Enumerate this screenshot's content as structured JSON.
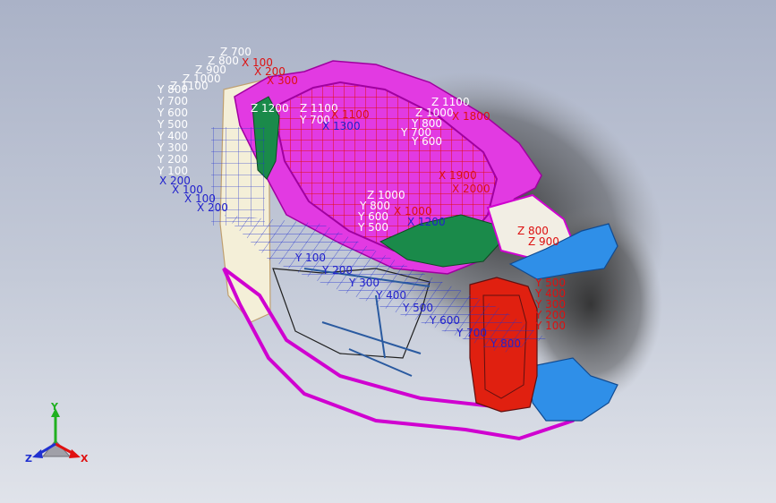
{
  "colors": {
    "background_top": "#aab2c7",
    "background_bottom": "#e0e3ea",
    "body_panel": "#d000d0",
    "mesh_red": "#e01010",
    "mesh_blue": "#2030d0",
    "green_panel": "#1a8a4a",
    "blue_part": "#2f8fe8",
    "red_part": "#e02010",
    "label_white": "#ffffff",
    "label_red": "#dd1111",
    "label_blue": "#2222cc",
    "triad_x": "#e01010",
    "triad_y": "#20b020",
    "triad_z": "#2030d0"
  },
  "left_grid_labels": {
    "y_ticks": [
      "Y 800",
      "Y 700",
      "Y 600",
      "Y 500",
      "Y 400",
      "Y 300",
      "Y 200",
      "Y 100"
    ],
    "top_tags": [
      "Z 700",
      "Z 800",
      "Z 900",
      "Z 1000",
      "Z 1100"
    ],
    "x_top": [
      "X 100",
      "X 200",
      "X 300"
    ],
    "x_bottom": [
      "X 200",
      "X 100",
      "X 100",
      "X 200"
    ]
  },
  "center_labels": {
    "z_tags": [
      "Z 1000",
      "Z 1100",
      "Z 1200"
    ],
    "y_tags": [
      "Y 800",
      "Y 700",
      "Y 600",
      "Y 500"
    ],
    "x_tags": [
      "X 1000",
      "X 1100",
      "X 1200",
      "X 1300"
    ]
  },
  "right_labels": {
    "z_tags": [
      "Z 1100",
      "Z 1000"
    ],
    "y_tags": [
      "Y 800",
      "Y 700",
      "Y 600"
    ],
    "x_tags": [
      "X 1800",
      "X 1900",
      "X 2000"
    ],
    "z_side": [
      "Z 800",
      "Z 900"
    ],
    "y_side": [
      "Y 500",
      "Y 400",
      "Y 300",
      "Y 200",
      "Y 100"
    ]
  },
  "bottom_labels": {
    "blue_tags": [
      "Y 100",
      "Y 200",
      "Y 300",
      "Y 400",
      "Y 500",
      "Y 600",
      "Y 700",
      "Y 800"
    ]
  },
  "triad": {
    "x_label": "X",
    "y_label": "Y",
    "z_label": "Z"
  }
}
